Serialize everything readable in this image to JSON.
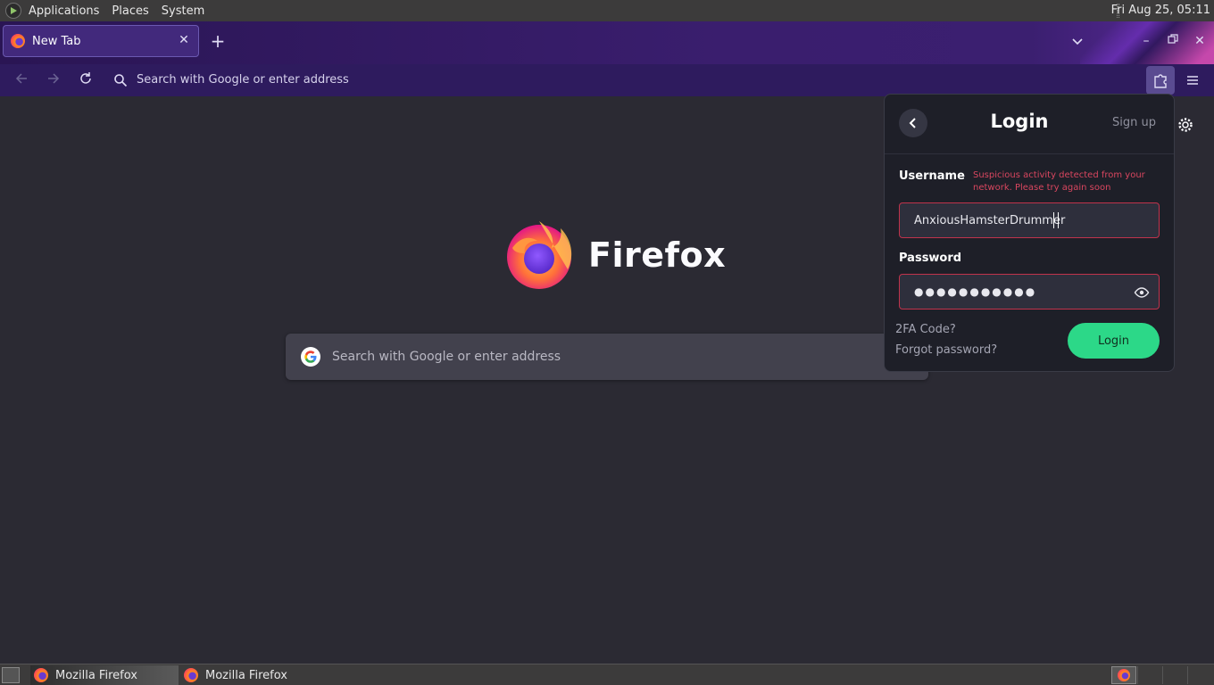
{
  "system_panel": {
    "menus": [
      "Applications",
      "Places",
      "System"
    ],
    "clock": "Fri Aug 25, 05:11"
  },
  "browser": {
    "tab": {
      "title": "New Tab"
    },
    "urlbar": {
      "placeholder": "Search with Google or enter address"
    },
    "theme_colors": {
      "tabstrip": "#3a1e6e",
      "navbar": "#2e1b5e",
      "content_bg": "#2b2a33"
    }
  },
  "newtab": {
    "brand": "Firefox",
    "search_placeholder": "Search with Google or enter address"
  },
  "login_popup": {
    "title": "Login",
    "signup_link": "Sign up",
    "username_label": "Username",
    "error_message": "Suspicious activity detected from your network. Please try again soon",
    "username_value": "AnxiousHamsterDrummer",
    "password_label": "Password",
    "password_value": "●●●●●●●●●●●",
    "twofa_link": "2FA Code?",
    "forgot_link": "Forgot password?",
    "login_button": "Login",
    "accent_color": "#2cd888",
    "error_color": "#d9465f"
  },
  "taskbar": {
    "tasks": [
      {
        "label": "Mozilla Firefox"
      },
      {
        "label": "Mozilla Firefox"
      }
    ]
  }
}
